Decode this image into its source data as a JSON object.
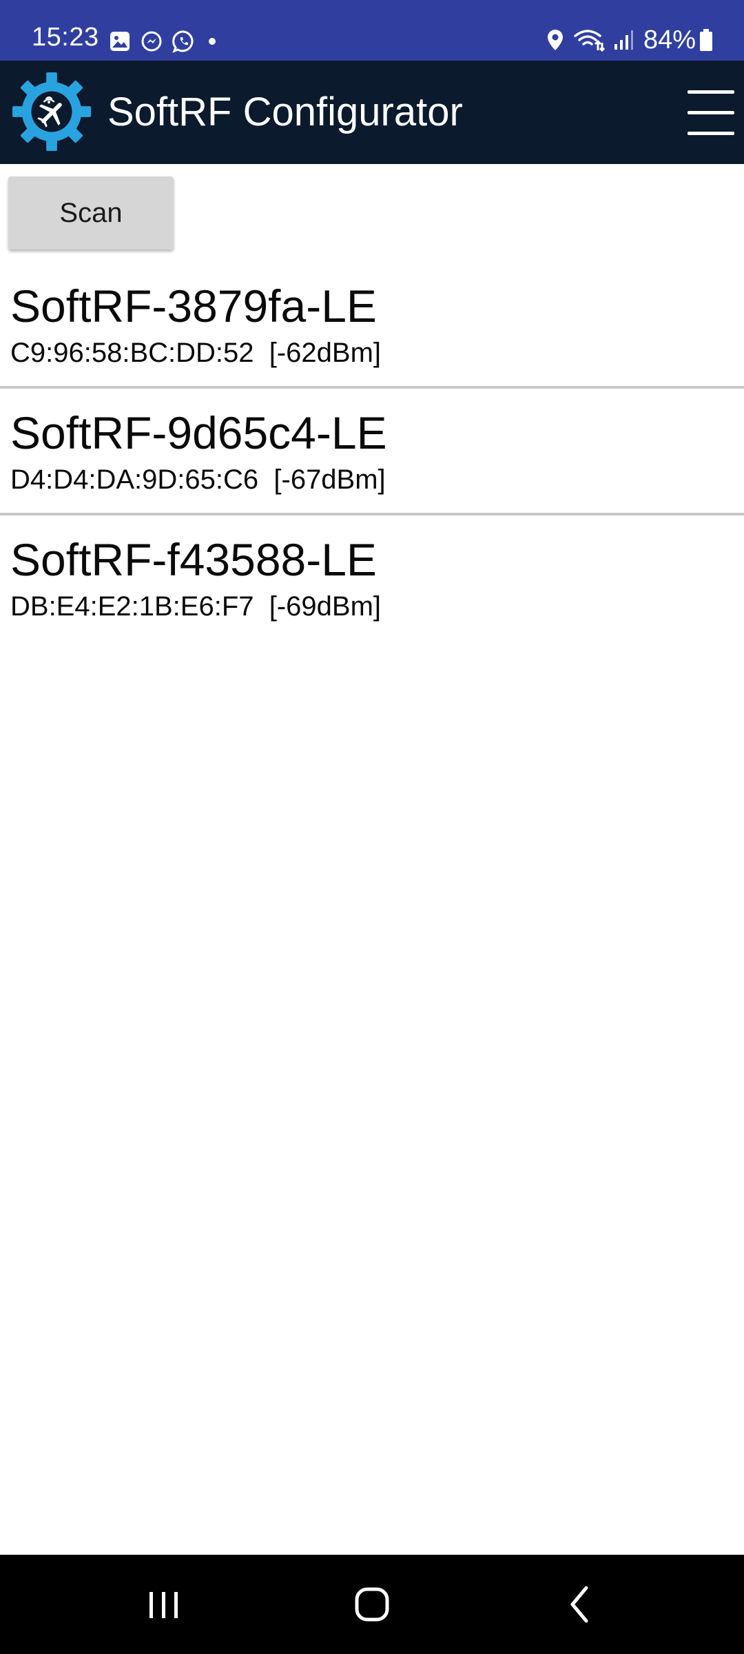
{
  "status_bar": {
    "time": "15:23",
    "left_icons": [
      "gallery-icon",
      "messenger-icon",
      "whatsapp-icon",
      "notification-dot-icon"
    ],
    "right_icons": [
      "location-icon",
      "wifi-icon",
      "signal-icon",
      "battery-icon"
    ],
    "battery": "84%"
  },
  "app_bar": {
    "title": "SoftRF Configurator",
    "logo_icon": "gear-airplane-icon",
    "menu_icon": "hamburger-menu-icon"
  },
  "scan_button": {
    "label": "Scan"
  },
  "devices": [
    {
      "name": "SoftRF-3879fa-LE",
      "info": "C9:96:58:BC:DD:52  [-62dBm]"
    },
    {
      "name": "SoftRF-9d65c4-LE",
      "info": "D4:D4:DA:9D:65:C6  [-67dBm]"
    },
    {
      "name": "SoftRF-f43588-LE",
      "info": "DB:E4:E2:1B:E6:F7  [-69dBm]"
    }
  ],
  "nav_bar": {
    "icons": [
      "recents-icon",
      "home-icon",
      "back-icon"
    ]
  },
  "colors": {
    "status_bar": "#303f9f",
    "app_bar": "#0b1a2c",
    "logo_gear": "#29a3e0",
    "scan_button": "#d6d6d6",
    "divider": "#c8c8c8",
    "nav_bar": "#000000"
  }
}
